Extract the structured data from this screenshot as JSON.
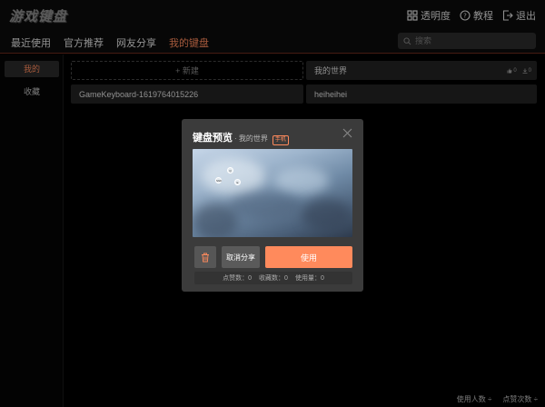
{
  "app": {
    "logo": "游戏键盘"
  },
  "top_actions": [
    {
      "label": "透明度",
      "icon": "grid-icon"
    },
    {
      "label": "教程",
      "icon": "help-icon"
    },
    {
      "label": "退出",
      "icon": "logout-icon"
    }
  ],
  "nav": {
    "tabs": [
      {
        "label": "最近使用"
      },
      {
        "label": "官方推荐"
      },
      {
        "label": "网友分享"
      },
      {
        "label": "我的键盘"
      }
    ],
    "active_tab": "我的键盘",
    "search_placeholder": "搜索"
  },
  "sidebar": {
    "items": [
      {
        "label": "我的"
      },
      {
        "label": "收藏"
      }
    ],
    "active": "我的"
  },
  "grid": {
    "new_label": "+ 新建",
    "cards": [
      {
        "name": "我的世界",
        "likes": "0",
        "downloads": "0"
      },
      {
        "name": "GameKeyboard-1619764015226"
      },
      {
        "name": "heiheihei"
      }
    ]
  },
  "modal": {
    "title": "键盘预览",
    "subtitle": "· 我的世界",
    "badge": "手机",
    "unshare_label": "取消分享",
    "use_label": "使用",
    "stats": [
      {
        "label": "点赞数：",
        "value": "0"
      },
      {
        "label": "收藏数：",
        "value": "0"
      },
      {
        "label": "使用量：",
        "value": "0"
      }
    ],
    "preview_keys": [
      "Q",
      "Shift",
      "E"
    ]
  },
  "bottom": {
    "sort_users": "使用人数 ÷",
    "sort_likes": "点赞次数 ÷"
  },
  "colors": {
    "accent": "#ff8a5c",
    "background": "#000000",
    "card": "#222222",
    "modal": "#3b3b3b"
  }
}
